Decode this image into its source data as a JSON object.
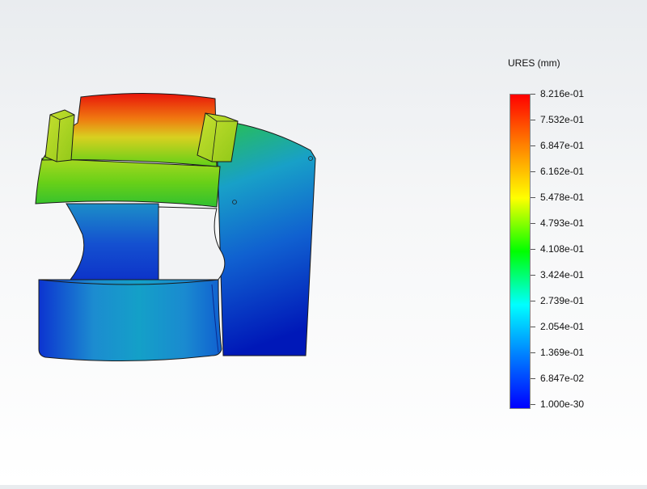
{
  "legend": {
    "title": "URES (mm)",
    "ticks": [
      "8.216e-01",
      "7.532e-01",
      "6.847e-01",
      "6.162e-01",
      "5.478e-01",
      "4.793e-01",
      "4.108e-01",
      "3.424e-01",
      "2.739e-01",
      "2.054e-01",
      "1.369e-01",
      "6.847e-02",
      "1.000e-30"
    ],
    "colors": [
      "#ff0000",
      "#ff8000",
      "#ffff00",
      "#00ff00",
      "#00ffff",
      "#0080ff",
      "#0000ff"
    ]
  }
}
